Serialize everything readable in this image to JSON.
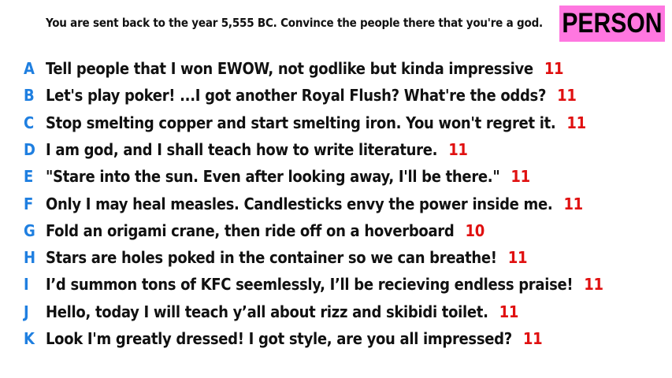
{
  "prompt": "You are sent back to the year 5,555 BC. Convince the people there that you're a god.",
  "badge": {
    "label": "PERSON",
    "color": "#ff77e0"
  },
  "colors": {
    "letter": "#1f7fe0",
    "score": "#e01010",
    "text": "#111111"
  },
  "answers": [
    {
      "letter": "A",
      "text": "Tell people that I won EWOW, not godlike but kinda impressive",
      "score": "11"
    },
    {
      "letter": "B",
      "text": "Let's play poker! ...I got another Royal Flush? What're the odds?",
      "score": "11"
    },
    {
      "letter": "C",
      "text": "Stop smelting copper and start smelting iron. You won't regret it.",
      "score": "11"
    },
    {
      "letter": "D",
      "text": "I am god, and I shall teach how to write literature.",
      "score": "11"
    },
    {
      "letter": "E",
      "text": "\"Stare into the sun. Even after looking away, I'll be there.\"",
      "score": "11"
    },
    {
      "letter": "F",
      "text": "Only I may heal measles. Candlesticks envy the power inside me.",
      "score": "11"
    },
    {
      "letter": "G",
      "text": "Fold an origami crane, then ride off on a hoverboard",
      "score": "10"
    },
    {
      "letter": "H",
      "text": "Stars are holes poked in the container so we can breathe!",
      "score": "11"
    },
    {
      "letter": "I",
      "text": "I’d summon tons of KFC seemlessly, I’ll be recieving endless praise!",
      "score": "11"
    },
    {
      "letter": "J",
      "text": "Hello, today I will teach y’all about rizz and skibidi toilet.",
      "score": "11"
    },
    {
      "letter": "K",
      "text": "Look I'm greatly dressed! I got style, are you all impressed?",
      "score": "11"
    }
  ]
}
